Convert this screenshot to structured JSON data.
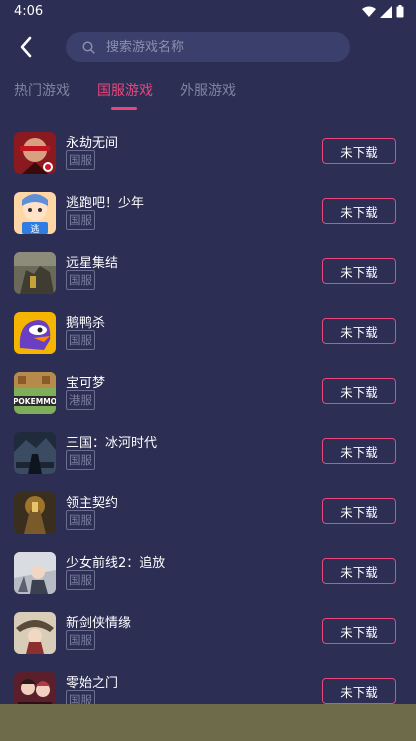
{
  "status_bar": {
    "time": "4:06"
  },
  "search": {
    "placeholder": "搜索游戏名称"
  },
  "tabs": [
    {
      "label": "热门游戏",
      "active": false
    },
    {
      "label": "国服游戏",
      "active": true
    },
    {
      "label": "外服游戏",
      "active": false
    }
  ],
  "games": [
    {
      "name": "永劫无间",
      "region": "国服",
      "action": "未下载"
    },
    {
      "name": "逃跑吧！少年",
      "region": "国服",
      "action": "未下载"
    },
    {
      "name": "远星集结",
      "region": "国服",
      "action": "未下载"
    },
    {
      "name": "鹅鸭杀",
      "region": "国服",
      "action": "未下载"
    },
    {
      "name": "宝可梦",
      "region": "港服",
      "action": "未下载"
    },
    {
      "name": "三国：冰河时代",
      "region": "国服",
      "action": "未下载"
    },
    {
      "name": "领主契约",
      "region": "国服",
      "action": "未下载"
    },
    {
      "name": "少女前线2：追放",
      "region": "国服",
      "action": "未下载"
    },
    {
      "name": "新剑侠情缘",
      "region": "国服",
      "action": "未下载"
    },
    {
      "name": "零始之门",
      "region": "国服",
      "action": "未下载"
    }
  ],
  "icon_text": {
    "game_1": "逃",
    "game_4": "POKEMMO"
  },
  "colors": {
    "background": "#2c2e54",
    "accent": "#e9467c",
    "search_bg": "#3b3f6b",
    "muted_text": "#80839f"
  }
}
